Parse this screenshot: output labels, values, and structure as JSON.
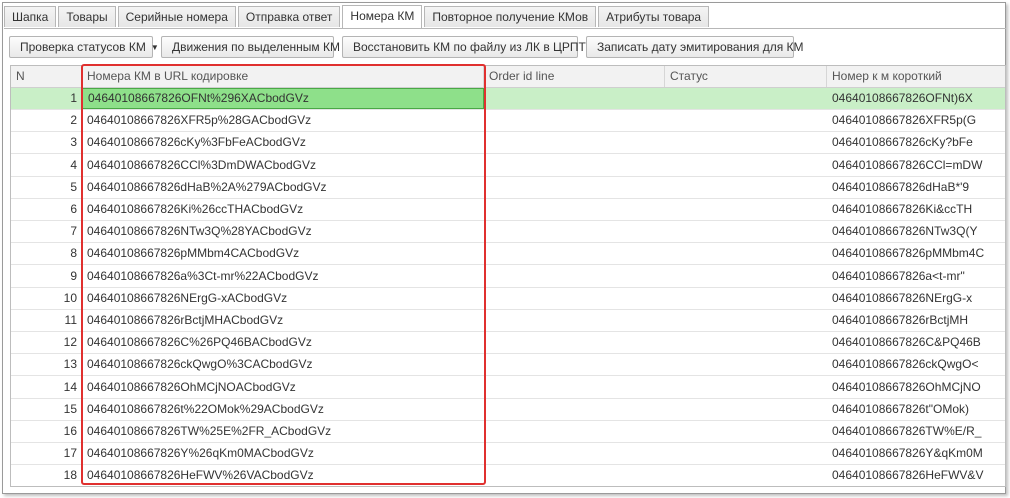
{
  "tabs": [
    {
      "label": "Шапка",
      "active": false
    },
    {
      "label": "Товары",
      "active": false
    },
    {
      "label": "Серийные номера",
      "active": false
    },
    {
      "label": "Отправка ответ",
      "active": false
    },
    {
      "label": "Номера КМ",
      "active": true
    },
    {
      "label": "Повторное получение КМов",
      "active": false
    },
    {
      "label": "Атрибуты товара",
      "active": false
    }
  ],
  "toolbar": {
    "check_status": "Проверка статусов КМ",
    "movements": "Движения по выделенным КМ",
    "restore": "Восстановить КМ по файлу из ЛК в ЦРПТ",
    "write_date": "Записать дату эмитирования для КМ"
  },
  "table": {
    "columns": {
      "n": "N",
      "url": "Номера КМ в URL кодировке",
      "order": "Order id line",
      "status": "Статус",
      "short": "Номер к м короткий"
    },
    "rows": [
      {
        "n": "1",
        "url": "04640108667826OFNt%296XACbodGVz",
        "order": "",
        "status": "",
        "short": "04640108667826OFNt)6X"
      },
      {
        "n": "2",
        "url": "04640108667826XFR5p%28GACbodGVz",
        "order": "",
        "status": "",
        "short": "04640108667826XFR5p(G"
      },
      {
        "n": "3",
        "url": "04640108667826cKy%3FbFeACbodGVz",
        "order": "",
        "status": "",
        "short": "04640108667826cKy?bFe"
      },
      {
        "n": "4",
        "url": "04640108667826CCl%3DmDWACbodGVz",
        "order": "",
        "status": "",
        "short": "04640108667826CCl=mDW"
      },
      {
        "n": "5",
        "url": "04640108667826dHaB%2A%279ACbodGVz",
        "order": "",
        "status": "",
        "short": "04640108667826dHaB*'9"
      },
      {
        "n": "6",
        "url": "04640108667826Ki%26ccTHACbodGVz",
        "order": "",
        "status": "",
        "short": "04640108667826Ki&ccTH"
      },
      {
        "n": "7",
        "url": "04640108667826NTw3Q%28YACbodGVz",
        "order": "",
        "status": "",
        "short": "04640108667826NTw3Q(Y"
      },
      {
        "n": "8",
        "url": "04640108667826pMMbm4CACbodGVz",
        "order": "",
        "status": "",
        "short": "04640108667826pMMbm4C"
      },
      {
        "n": "9",
        "url": "04640108667826a%3Ct-mr%22ACbodGVz",
        "order": "",
        "status": "",
        "short": "04640108667826a<t-mr\""
      },
      {
        "n": "10",
        "url": "04640108667826NErgG-xACbodGVz",
        "order": "",
        "status": "",
        "short": "04640108667826NErgG-x"
      },
      {
        "n": "11",
        "url": "04640108667826rBctjMHACbodGVz",
        "order": "",
        "status": "",
        "short": "04640108667826rBctjMH"
      },
      {
        "n": "12",
        "url": "04640108667826C%26PQ46BACbodGVz",
        "order": "",
        "status": "",
        "short": "04640108667826C&PQ46B"
      },
      {
        "n": "13",
        "url": "04640108667826ckQwgO%3CACbodGVz",
        "order": "",
        "status": "",
        "short": "04640108667826ckQwgO<"
      },
      {
        "n": "14",
        "url": "04640108667826OhMCjNOACbodGVz",
        "order": "",
        "status": "",
        "short": "04640108667826OhMCjNO"
      },
      {
        "n": "15",
        "url": "04640108667826t%22OMok%29ACbodGVz",
        "order": "",
        "status": "",
        "short": "04640108667826t\"OMok)"
      },
      {
        "n": "16",
        "url": "04640108667826TW%25E%2FR_ACbodGVz",
        "order": "",
        "status": "",
        "short": "04640108667826TW%E/R_"
      },
      {
        "n": "17",
        "url": "04640108667826Y%26qKm0MACbodGVz",
        "order": "",
        "status": "",
        "short": "04640108667826Y&qKm0M"
      },
      {
        "n": "18",
        "url": "04640108667826HeFWV%26VACbodGVz",
        "order": "",
        "status": "",
        "short": "04640108667826HeFWV&V"
      }
    ],
    "selected_row": "1"
  },
  "colors": {
    "selected_row": "#c9efc7",
    "selected_cell": "#8ee08a",
    "highlight_border": "#e0302f"
  }
}
